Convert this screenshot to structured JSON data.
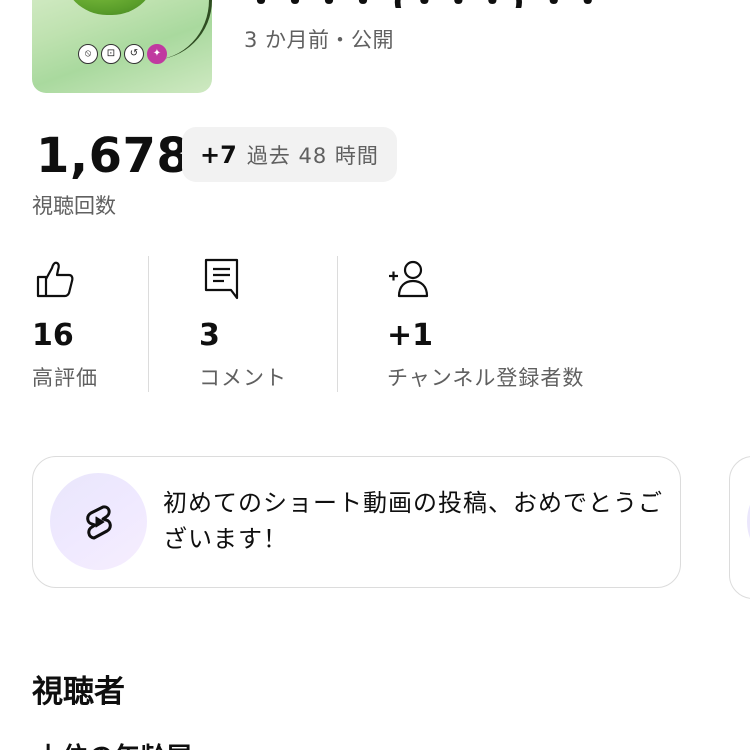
{
  "video": {
    "title_partial": "・・・・ (・・・) ・・",
    "meta": "3 か月前・公開",
    "thumbnail_badges": [
      "⦸",
      "⊡",
      "↺",
      "✦"
    ]
  },
  "views": {
    "count": "1,678",
    "delta_value": "+7",
    "delta_label": "過去 48 時間",
    "label": "視聴回数"
  },
  "stats": [
    {
      "icon": "thumbs-up-icon",
      "value": "16",
      "label": "高評価"
    },
    {
      "icon": "comment-icon",
      "value": "3",
      "label": "コメント"
    },
    {
      "icon": "add-subscriber-icon",
      "value": "+1",
      "label": "チャンネル登録者数"
    }
  ],
  "congrats_card": {
    "icon": "shorts-icon",
    "message": "初めてのショート動画の投稿、おめでとうございます！"
  },
  "audience": {
    "title": "視聴者",
    "subtitle_partial": "上位の年齢層"
  },
  "colors": {
    "text_primary": "#0f0f0f",
    "text_secondary": "#606060",
    "pill_bg": "#f2f2f2",
    "border": "#dcdcdc",
    "shorts_circle": "#ece8fc"
  }
}
